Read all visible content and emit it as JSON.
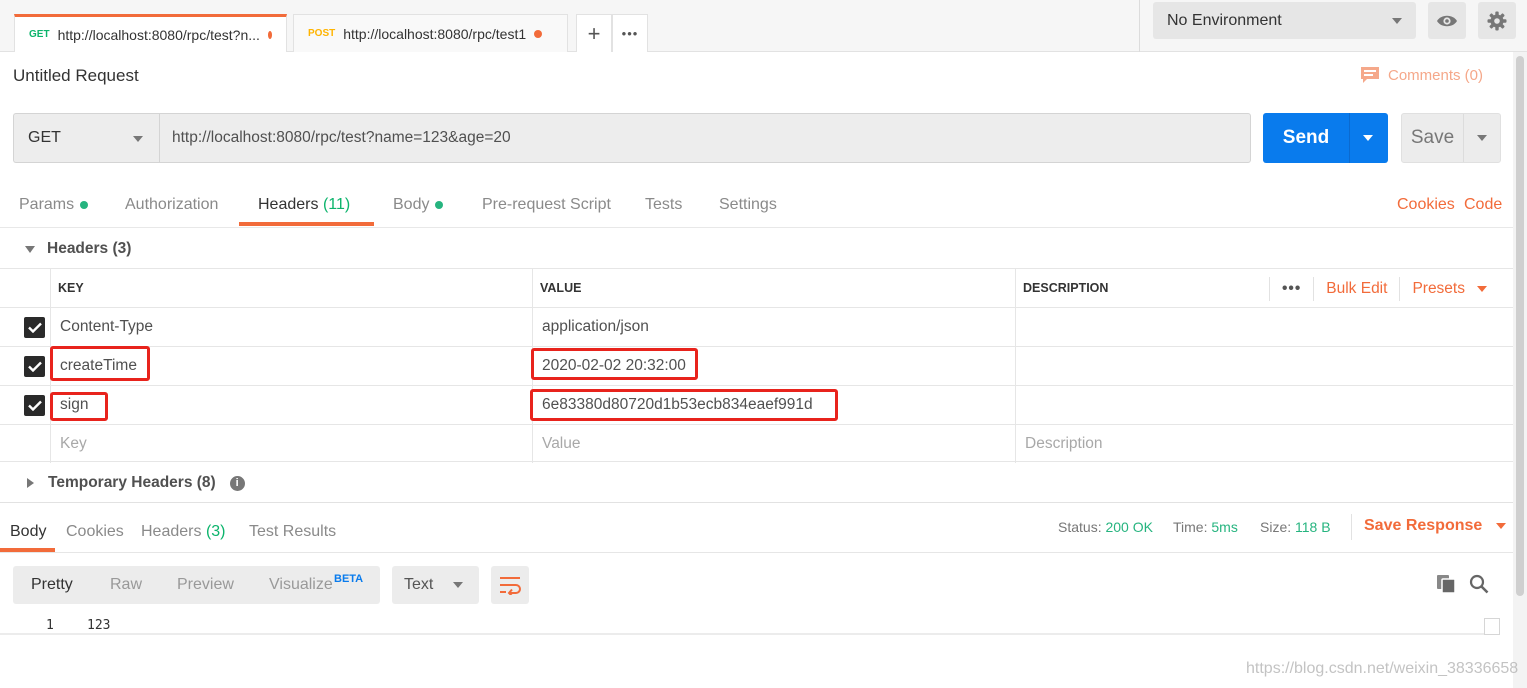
{
  "tabs": [
    {
      "method": "GET",
      "url": "http://localhost:8080/rpc/test?n..."
    },
    {
      "method": "POST",
      "url": "http://localhost:8080/rpc/test1"
    }
  ],
  "tab_actions": {
    "new": "+",
    "more": "•••"
  },
  "environment": {
    "selected": "No Environment"
  },
  "request": {
    "title": "Untitled Request",
    "comments": "Comments (0)",
    "method": "GET",
    "url": "http://localhost:8080/rpc/test?name=123&age=20",
    "send_label": "Send",
    "save_label": "Save"
  },
  "request_tabs": {
    "params": "Params",
    "authorization": "Authorization",
    "headers": "Headers",
    "headers_count": "(11)",
    "body": "Body",
    "prerequest": "Pre-request Script",
    "tests": "Tests",
    "settings": "Settings",
    "cookies_link": "Cookies",
    "code_link": "Code"
  },
  "headers_section": {
    "title": "Headers (3)",
    "columns": {
      "key": "KEY",
      "value": "VALUE",
      "description": "DESCRIPTION"
    },
    "more": "•••",
    "bulk_edit": "Bulk Edit",
    "presets": "Presets",
    "rows": [
      {
        "key": "Content-Type",
        "value": "application/json",
        "description": "",
        "checked": true
      },
      {
        "key": "createTime",
        "value": "2020-02-02 20:32:00",
        "description": "",
        "checked": true
      },
      {
        "key": "sign",
        "value": "6e83380d80720d1b53ecb834eaef991d",
        "description": "",
        "checked": true
      }
    ],
    "placeholder": {
      "key": "Key",
      "value": "Value",
      "description": "Description"
    }
  },
  "temp_headers": {
    "title": "Temporary Headers (8)",
    "info": "i"
  },
  "response": {
    "tabs": {
      "body": "Body",
      "cookies": "Cookies",
      "headers": "Headers",
      "headers_count": "(3)",
      "test_results": "Test Results"
    },
    "status_label": "Status:",
    "status_value": "200 OK",
    "time_label": "Time:",
    "time_value": "5ms",
    "size_label": "Size:",
    "size_value": "118 B",
    "save_response": "Save Response",
    "views": {
      "pretty": "Pretty",
      "raw": "Raw",
      "preview": "Preview",
      "visualize": "Visualize",
      "beta": "BETA"
    },
    "format": "Text",
    "line_number": "1",
    "body_text": "123"
  },
  "watermark": "https://blog.csdn.net/weixin_38336658",
  "colors": {
    "accent": "#f26b3a",
    "send": "#097bed",
    "success": "#26b47f",
    "highlight": "#e8231c"
  },
  "icons": [
    "eye-icon",
    "gear-icon",
    "comment-icon",
    "wrap-icon",
    "copy-icon",
    "search-icon",
    "info-icon",
    "checkbox-icon"
  ]
}
